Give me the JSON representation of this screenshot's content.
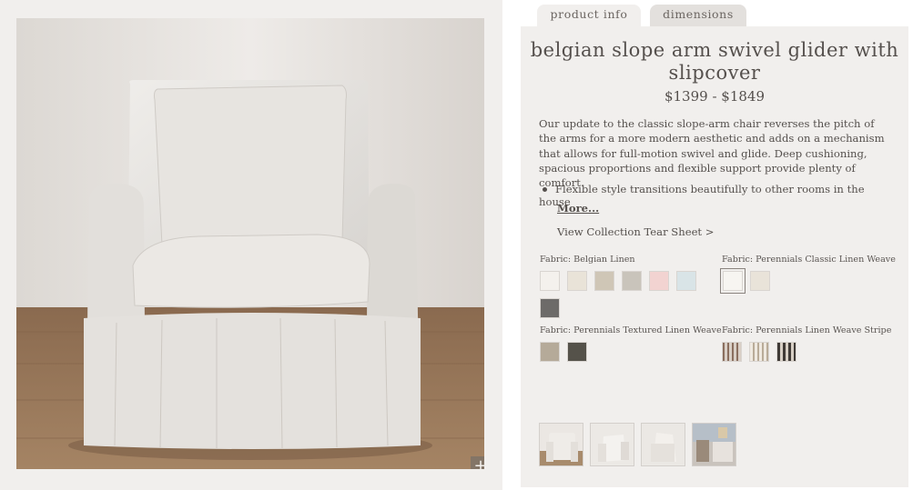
{
  "tabs": [
    {
      "label": "product info",
      "active": true
    },
    {
      "label": "dimensions",
      "active": false
    }
  ],
  "product": {
    "title": "belgian slope arm swivel glider with slipcover",
    "price": "$1399 - $1849",
    "description": "Our update to the classic slope-arm chair reverses the pitch of the arms for a more modern aesthetic and adds on a mechanism that allows for full-motion swivel and glide. Deep cushioning, spacious proportions and flexible support provide plenty of comfort.",
    "bullets": [
      "Flexible style transitions beautifully to other rooms in the house"
    ],
    "more_label": "More...",
    "tear_sheet_label": "View Collection Tear Sheet >"
  },
  "image": {
    "zoom_label": "+"
  },
  "fabrics": [
    {
      "label": "Fabric: Belgian Linen",
      "swatches": [
        "#f4f1ed",
        "#e9e3d8",
        "#cfc6b6",
        "#c9c4bb",
        "#f2d3d1",
        "#d9e4e7",
        "#6d6b69"
      ]
    },
    {
      "label": "Fabric: Perennials Classic Linen Weave",
      "swatches": [
        "#f7f5f1",
        "#e9e3d9"
      ]
    },
    {
      "label": "Fabric: Perennials Textured Linen Weave",
      "swatches": [
        "#b5aa99",
        "#55524a"
      ]
    },
    {
      "label": "Fabric: Perennials Linen Weave Stripe",
      "swatches": [
        "stripe-brown",
        "stripe-cream",
        "stripe-dark"
      ]
    }
  ],
  "thumbnails": [
    "chair-front",
    "chair-angle",
    "chair-side",
    "chair-room"
  ]
}
